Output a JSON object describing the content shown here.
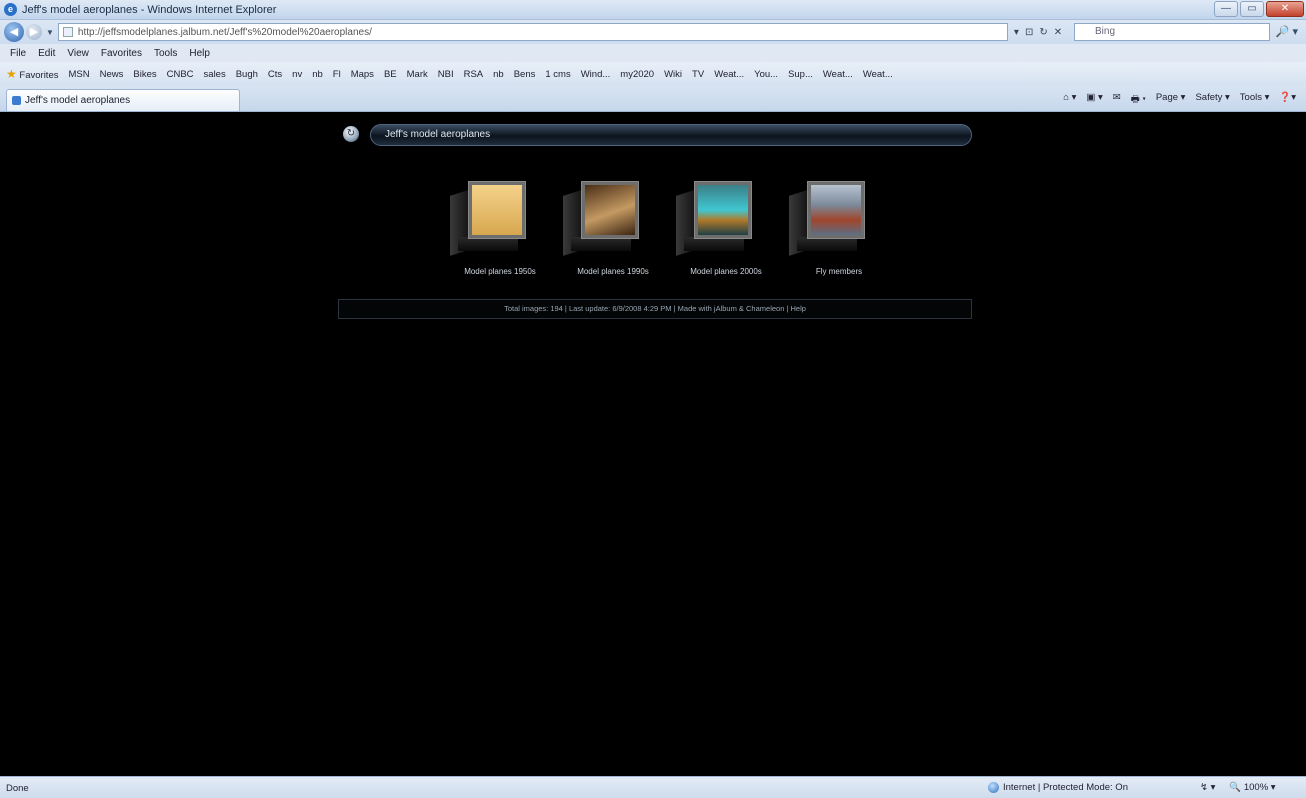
{
  "window": {
    "title": "Jeff's model aeroplanes - Windows Internet Explorer",
    "controls": {
      "minimize": "—",
      "restore": "▭",
      "close": "✕"
    }
  },
  "addressbar": {
    "url": "http://jeffsmodelplanes.jalbum.net/Jeff's%20model%20aeroplanes/",
    "tools": [
      "▾",
      "⊡",
      "↻",
      "✕"
    ],
    "search_placeholder": "Bing",
    "search_go": "🔎 ▾"
  },
  "menubar": [
    "File",
    "Edit",
    "View",
    "Favorites",
    "Tools",
    "Help"
  ],
  "favorites": {
    "label": "Favorites",
    "items": [
      "MSN",
      "News",
      "Bikes",
      "CNBC",
      "sales",
      "Bugh",
      "Cts",
      "nv",
      "nb",
      "Fl",
      "Maps",
      "BE",
      "Mark",
      "NBI",
      "RSA",
      "nb",
      "Bens",
      "1 cms",
      "Wind...",
      "my2020",
      "Wiki",
      "TV",
      "Weat...",
      "You...",
      "Sup...",
      "Weat...",
      "Weat..."
    ]
  },
  "tab": {
    "label": "Jeff's model aeroplanes"
  },
  "commandbar": [
    "⌂ ▾",
    "▣ ▾",
    "✉",
    "🖶 ▾",
    "Page ▾",
    "Safety ▾",
    "Tools ▾",
    "❓▾"
  ],
  "page": {
    "header_icon": "↻",
    "header_title": "Jeff's model aeroplanes",
    "albums": [
      {
        "caption": "Model planes 1950s"
      },
      {
        "caption": "Model planes 1990s"
      },
      {
        "caption": "Model planes 2000s"
      },
      {
        "caption": "Fly members"
      }
    ],
    "footer": "Total images: 194 | Last update: 6/9/2008 4:29 PM | Made with jAlbum & Chameleon | Help"
  },
  "statusbar": {
    "left": "Done",
    "zone": "Internet | Protected Mode: On",
    "zoom_control": "↯ ▾",
    "zoom": "🔍 100% ▾"
  }
}
